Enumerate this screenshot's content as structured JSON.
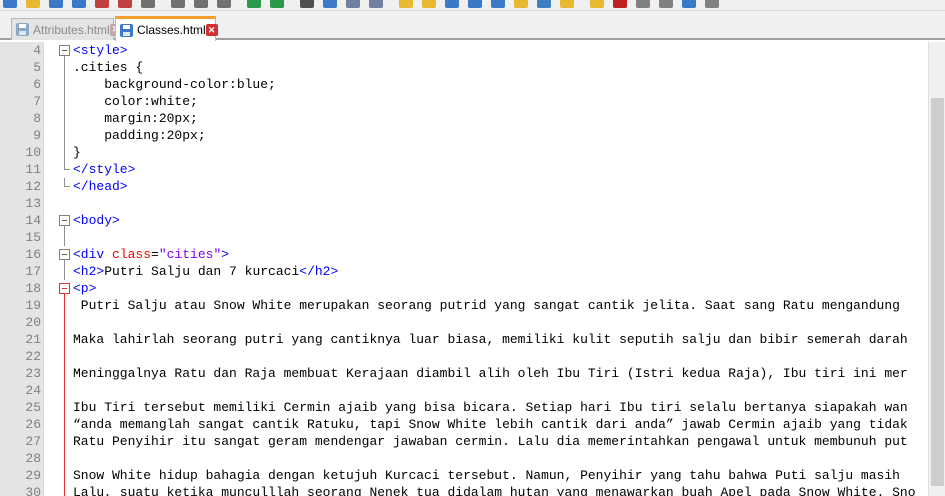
{
  "toolbar": {
    "icons": [
      "new-file-icon",
      "open-icon",
      "save-icon",
      "save-all-icon",
      "close-icon",
      "close-all-icon",
      "print-icon",
      "cut-icon",
      "copy-icon",
      "paste-icon",
      "undo-icon",
      "redo-icon",
      "find-icon",
      "replace-icon",
      "zoom-in-icon",
      "zoom-out-icon",
      "sync-v-icon",
      "sync-h-icon",
      "word-wrap-icon",
      "all-chars-icon",
      "indent-guide-icon",
      "lang-icon",
      "doc-map-icon",
      "function-list-icon",
      "folder-icon",
      "record-icon",
      "stop-icon",
      "play-icon",
      "play-multi-icon",
      "save-macro-icon"
    ]
  },
  "tabs": [
    {
      "label": "Attributes.html",
      "close": "✕"
    },
    {
      "label": "Classes.html",
      "close": "✕"
    }
  ],
  "editor": {
    "lines": [
      {
        "num": "4",
        "fold": "box",
        "tokens": [
          {
            "t": "tag",
            "v": "<style>"
          }
        ]
      },
      {
        "num": "5",
        "fold": "line",
        "tokens": [
          {
            "t": "txt",
            "v": ".cities {"
          }
        ]
      },
      {
        "num": "6",
        "fold": "line",
        "tokens": [
          {
            "t": "txt",
            "v": "    background-color:blue;"
          }
        ]
      },
      {
        "num": "7",
        "fold": "line",
        "tokens": [
          {
            "t": "txt",
            "v": "    color:white;"
          }
        ]
      },
      {
        "num": "8",
        "fold": "line",
        "tokens": [
          {
            "t": "txt",
            "v": "    margin:20px;"
          }
        ]
      },
      {
        "num": "9",
        "fold": "line",
        "tokens": [
          {
            "t": "txt",
            "v": "    padding:20px;"
          }
        ]
      },
      {
        "num": "10",
        "fold": "line",
        "tokens": [
          {
            "t": "txt",
            "v": "}"
          }
        ]
      },
      {
        "num": "11",
        "fold": "end",
        "tokens": [
          {
            "t": "tag",
            "v": "</style>"
          }
        ]
      },
      {
        "num": "12",
        "fold": "end",
        "tokens": [
          {
            "t": "tag",
            "v": "</head>"
          }
        ]
      },
      {
        "num": "13",
        "fold": "",
        "tokens": []
      },
      {
        "num": "14",
        "fold": "box",
        "tokens": [
          {
            "t": "tag",
            "v": "<body>"
          }
        ]
      },
      {
        "num": "15",
        "fold": "line",
        "tokens": []
      },
      {
        "num": "16",
        "fold": "box",
        "tokens": [
          {
            "t": "tag",
            "v": "<div "
          },
          {
            "t": "attr",
            "v": "class"
          },
          {
            "t": "txt",
            "v": "="
          },
          {
            "t": "val",
            "v": "\"cities\""
          },
          {
            "t": "tag",
            "v": ">"
          }
        ]
      },
      {
        "num": "17",
        "fold": "line",
        "tokens": [
          {
            "t": "tag",
            "v": "<h2>"
          },
          {
            "t": "txt",
            "v": "Putri Salju dan 7 kurcaci"
          },
          {
            "t": "tag",
            "v": "</h2>"
          }
        ]
      },
      {
        "num": "18",
        "fold": "boxred",
        "tokens": [
          {
            "t": "tag",
            "v": "<p>"
          }
        ]
      },
      {
        "num": "19",
        "fold": "redline",
        "tokens": [
          {
            "t": "txt",
            "v": " Putri Salju atau Snow White merupakan seorang putrid yang sangat cantik jelita. Saat sang Ratu mengandung"
          }
        ]
      },
      {
        "num": "20",
        "fold": "redline",
        "tokens": []
      },
      {
        "num": "21",
        "fold": "redline",
        "tokens": [
          {
            "t": "txt",
            "v": "Maka lahirlah seorang putri yang cantiknya luar biasa, memiliki kulit seputih salju dan bibir semerah darah"
          }
        ]
      },
      {
        "num": "22",
        "fold": "redline",
        "tokens": []
      },
      {
        "num": "23",
        "fold": "redline",
        "tokens": [
          {
            "t": "txt",
            "v": "Meninggalnya Ratu dan Raja membuat Kerajaan diambil alih oleh Ibu Tiri (Istri kedua Raja), Ibu tiri ini mer"
          }
        ]
      },
      {
        "num": "24",
        "fold": "redline",
        "tokens": []
      },
      {
        "num": "25",
        "fold": "redline",
        "tokens": [
          {
            "t": "txt",
            "v": "Ibu Tiri tersebut memiliki Cermin ajaib yang bisa bicara. Setiap hari Ibu tiri selalu bertanya siapakah wan"
          }
        ]
      },
      {
        "num": "26",
        "fold": "redline",
        "tokens": [
          {
            "t": "txt",
            "v": "“anda memanglah sangat cantik Ratuku, tapi Snow White lebih cantik dari anda” jawab Cermin ajaib yang tidak"
          }
        ]
      },
      {
        "num": "27",
        "fold": "redline",
        "tokens": [
          {
            "t": "txt",
            "v": "Ratu Penyihir itu sangat geram mendengar jawaban cermin. Lalu dia memerintahkan pengawal untuk membunuh put"
          }
        ]
      },
      {
        "num": "28",
        "fold": "redline",
        "tokens": []
      },
      {
        "num": "29",
        "fold": "redline",
        "tokens": [
          {
            "t": "txt",
            "v": "Snow White hidup bahagia dengan ketujuh Kurcaci tersebut. Namun, Penyihir yang tahu bahwa Puti salju masih"
          }
        ]
      },
      {
        "num": "30",
        "fold": "redline",
        "tokens": [
          {
            "t": "txt",
            "v": "Lalu, suatu ketika munculllah seorang Nenek tua didalam hutan yang menawarkan buah Apel pada Snow White. Sno"
          }
        ]
      }
    ]
  },
  "colors": {
    "tag": "#0000ff",
    "attr": "#ff0000",
    "value": "#8000ff",
    "text": "#000000",
    "active_tab_accent": "#f7a030"
  }
}
